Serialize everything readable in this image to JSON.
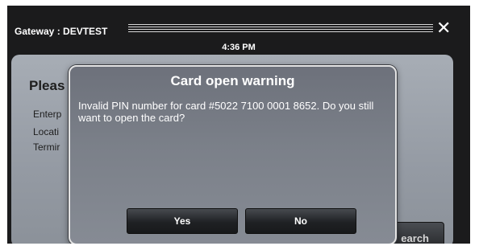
{
  "window": {
    "title": "Gateway : DEVTEST",
    "clock": "4:36 PM",
    "close_icon": "close-icon"
  },
  "background_panel": {
    "heading": "Pleas",
    "fields": [
      "Enterp",
      "Locati",
      "Termir"
    ],
    "search_label": "earch"
  },
  "dialog": {
    "title": "Card open warning",
    "message": "Invalid PIN number for card #5022 7100 0001 8652.  Do you still want to open the card?",
    "yes_label": "Yes",
    "no_label": "No"
  }
}
